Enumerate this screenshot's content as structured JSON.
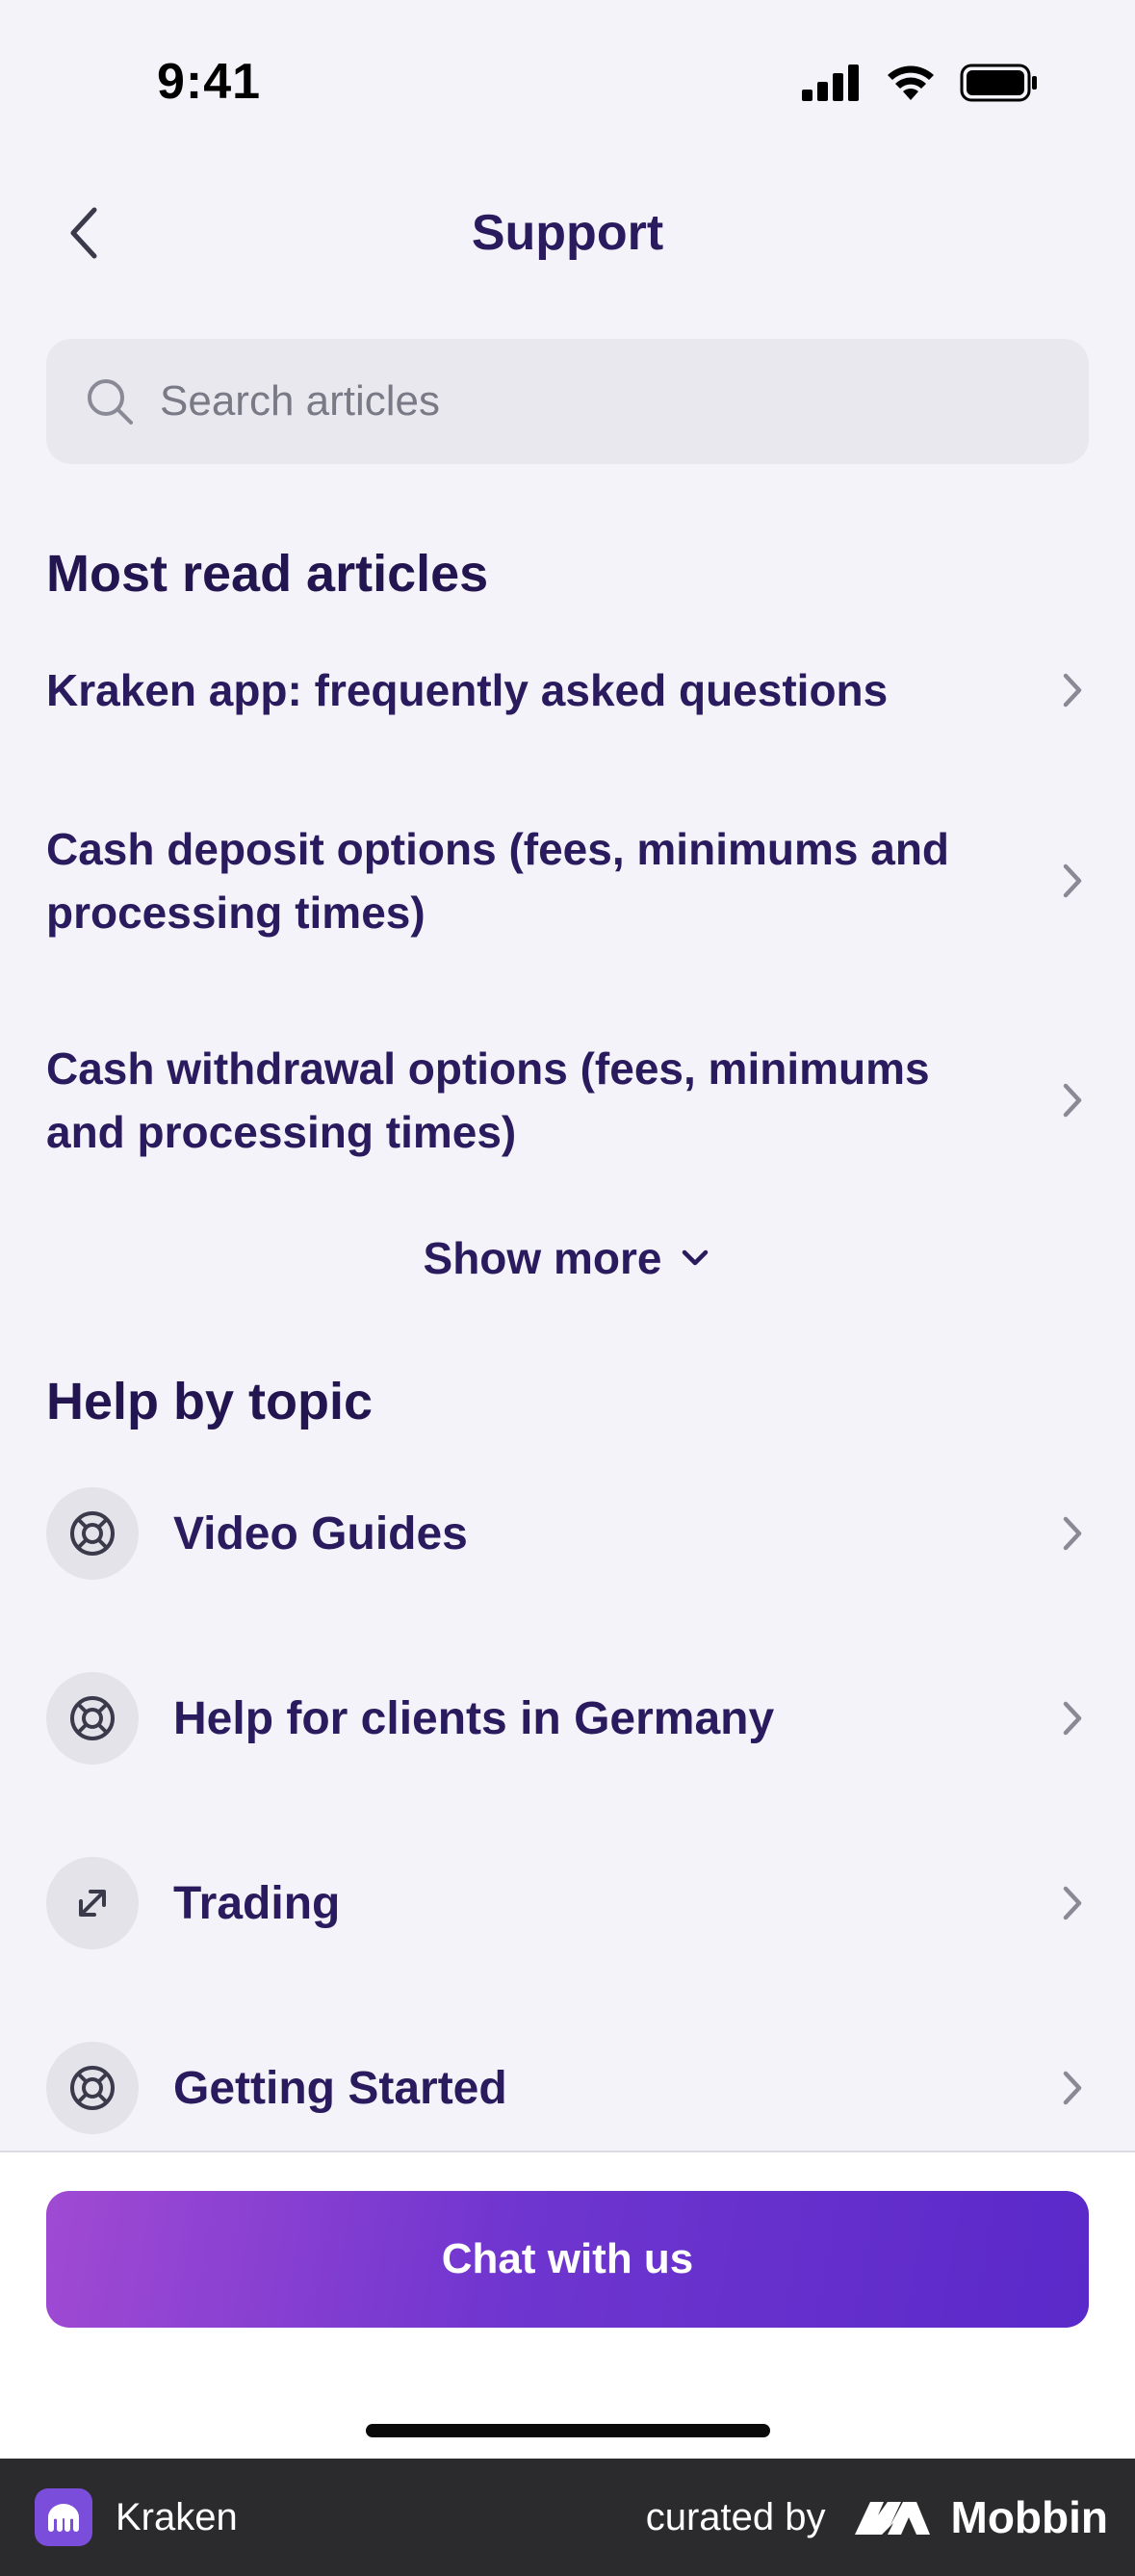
{
  "status_bar": {
    "time": "9:41"
  },
  "nav": {
    "title": "Support"
  },
  "search": {
    "placeholder": "Search articles"
  },
  "most_read": {
    "title": "Most read articles",
    "articles": [
      "Kraken app: frequently asked questions",
      "Cash deposit options (fees, minimums and processing times)",
      "Cash withdrawal options (fees, minimums and processing times)"
    ],
    "show_more": "Show more"
  },
  "help_topics": {
    "title": "Help by topic",
    "topics": [
      {
        "label": "Video Guides",
        "icon": "lifebuoy-icon"
      },
      {
        "label": "Help for clients in Germany",
        "icon": "lifebuoy-icon"
      },
      {
        "label": "Trading",
        "icon": "arrows-diagonal-icon"
      },
      {
        "label": "Getting Started",
        "icon": "lifebuoy-icon"
      }
    ]
  },
  "chat_button": {
    "label": "Chat with us"
  },
  "footer": {
    "app_name": "Kraken",
    "curated_by": "curated by",
    "brand": "Mobbin"
  },
  "colors": {
    "text": "#2a1a5e",
    "background": "#f4f3f9",
    "button_start": "#a04ad3",
    "button_end": "#5a29c9"
  }
}
